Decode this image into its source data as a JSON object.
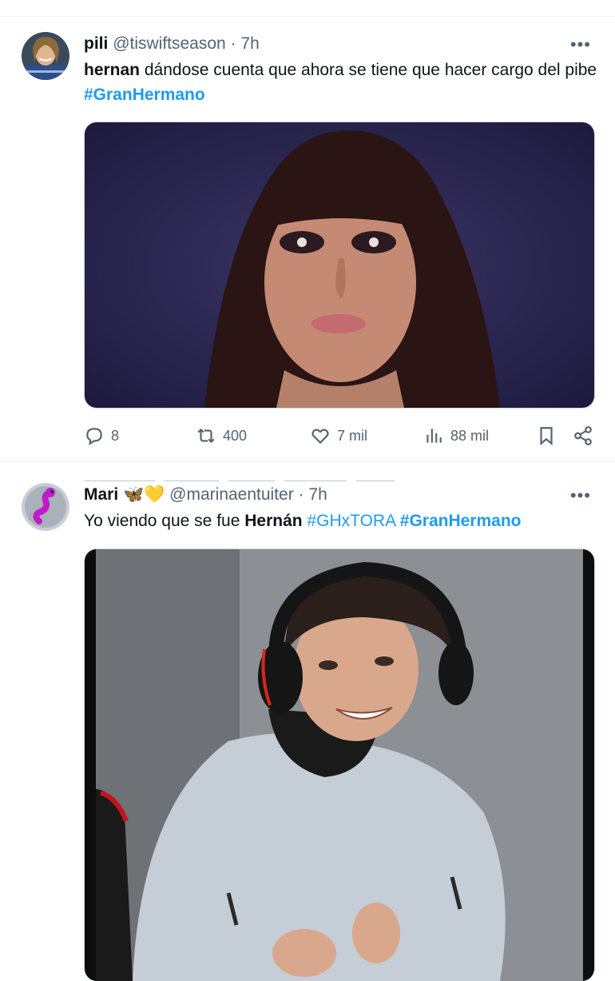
{
  "tweets": [
    {
      "name": "pili",
      "handle": "@tiswiftseason",
      "separator": "·",
      "time": "7h",
      "more": "•••",
      "text": {
        "bold_lead": "hernan",
        "body": " dándose cuenta que ahora se tiene que hacer cargo del pibe ",
        "hashtag": "#GranHermano"
      },
      "actions": {
        "replies": "8",
        "retweets": "400",
        "likes": "7 mil",
        "views": "88 mil"
      }
    },
    {
      "name": "Mari",
      "emoji": "🦋💛",
      "handle": "@marinaentuiter",
      "separator": "·",
      "time": "7h",
      "more": "•••",
      "text": {
        "lead": "Yo viendo que se fue ",
        "bold_word": "Hernán",
        "space": " ",
        "hashtag1": "#GHxTORA",
        "hashtag2": "#GranHermano"
      }
    }
  ],
  "icons": [
    "reply-icon",
    "retweet-icon",
    "like-icon",
    "views-icon",
    "bookmark-icon",
    "share-icon",
    "more-icon"
  ],
  "colors": {
    "hashtag": "#1d9bf0",
    "secondary_text": "#536471",
    "divider": "#eff3f4"
  }
}
